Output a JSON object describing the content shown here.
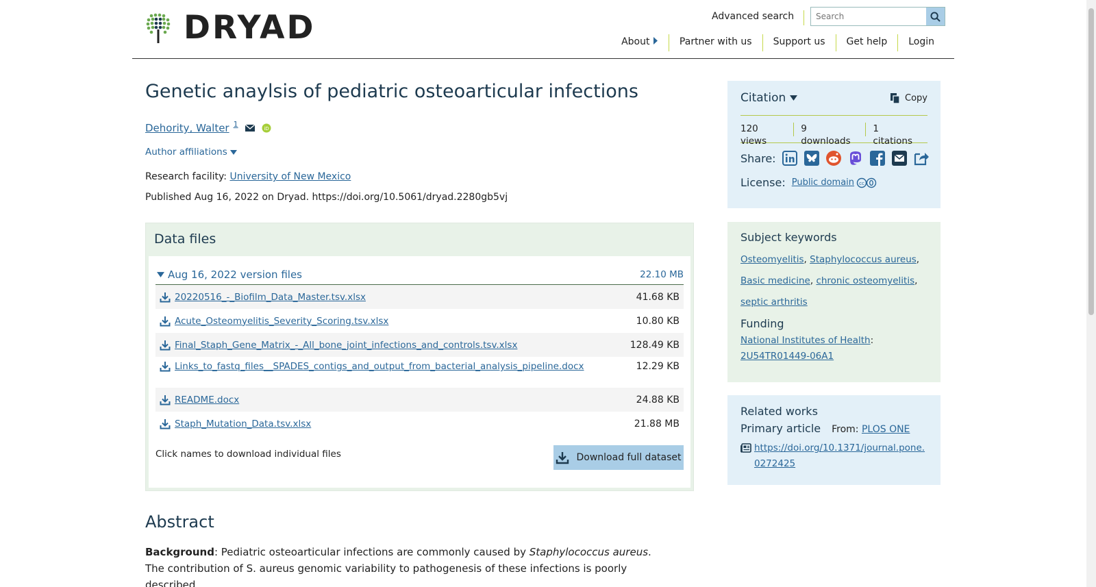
{
  "header": {
    "logo_text": "DRYAD",
    "advanced_search": "Advanced search",
    "search_placeholder": "Search",
    "nav": [
      "About",
      "Partner with us",
      "Support us",
      "Get help",
      "Login"
    ]
  },
  "dataset": {
    "title": "Genetic anaylsis of pediatric osteoarticular infections",
    "author": "Dehority, Walter",
    "author_affil_num": "1",
    "affiliations_toggle": "Author affiliations",
    "facility_label": "Research facility:",
    "facility": "University of New Mexico",
    "published": "Published Aug 16, 2022 on Dryad. https://doi.org/10.5061/dryad.2280gb5vj"
  },
  "datafiles": {
    "title": "Data files",
    "version_label": "Aug 16, 2022 version files",
    "version_size": "22.10 MB",
    "files": [
      {
        "name": "20220516_-_Biofilm_Data_Master.tsv.xlsx",
        "size": "41.68 KB"
      },
      {
        "name": "Acute_Osteomyelitis_Severity_Scoring.tsv.xlsx",
        "size": "10.80 KB"
      },
      {
        "name": "Final_Staph_Gene_Matrix_-_All_bone_joint_infections_and_controls.tsv.xlsx",
        "size": "128.49 KB"
      },
      {
        "name": "Links_to_fastq_files__SPADES_contigs_and_output_from_bacterial_analysis_pipeline.docx",
        "size": "12.29 KB"
      },
      {
        "name": "README.docx",
        "size": "24.88 KB"
      },
      {
        "name": "Staph_Mutation_Data.tsv.xlsx",
        "size": "21.88 MB"
      }
    ],
    "hint": "Click names to download individual files",
    "download_full": "Download full dataset"
  },
  "abstract": {
    "heading": "Abstract",
    "bg_label": "Background",
    "text_pre": ": Pediatric osteoarticular infections are commonly caused by ",
    "organism": "Staphylococcus aureus",
    "text_post": ". The contribution of S. aureus genomic variability to pathogenesis of these infections is poorly described."
  },
  "citation": {
    "title": "Citation",
    "copy": "Copy",
    "views": "120 views",
    "downloads": "9 downloads",
    "citations": "1 citations",
    "share_label": "Share:",
    "license_label": "License:",
    "license": "Public domain"
  },
  "keywords": {
    "heading": "Subject keywords",
    "items": [
      "Osteomyelitis",
      "Staphylococcus aureus",
      "Basic medicine",
      "chronic osteomyelitis",
      "septic arthritis"
    ],
    "funding_heading": "Funding",
    "funder": "National Institutes of Health",
    "grant": "2U54TR01449-06A1"
  },
  "related": {
    "heading": "Related works",
    "primary": "Primary article",
    "from_label": "From:",
    "from": "PLOS ONE",
    "doi": "https://doi.org/10.1371/journal.pone.0272425"
  },
  "colors": {
    "accent_blue": "#2a6799",
    "heading_navy": "#1d3a4f",
    "lime": "#b4c84a",
    "citation_bg": "#e3f0f8",
    "keyword_bg": "#e8f2e8"
  }
}
